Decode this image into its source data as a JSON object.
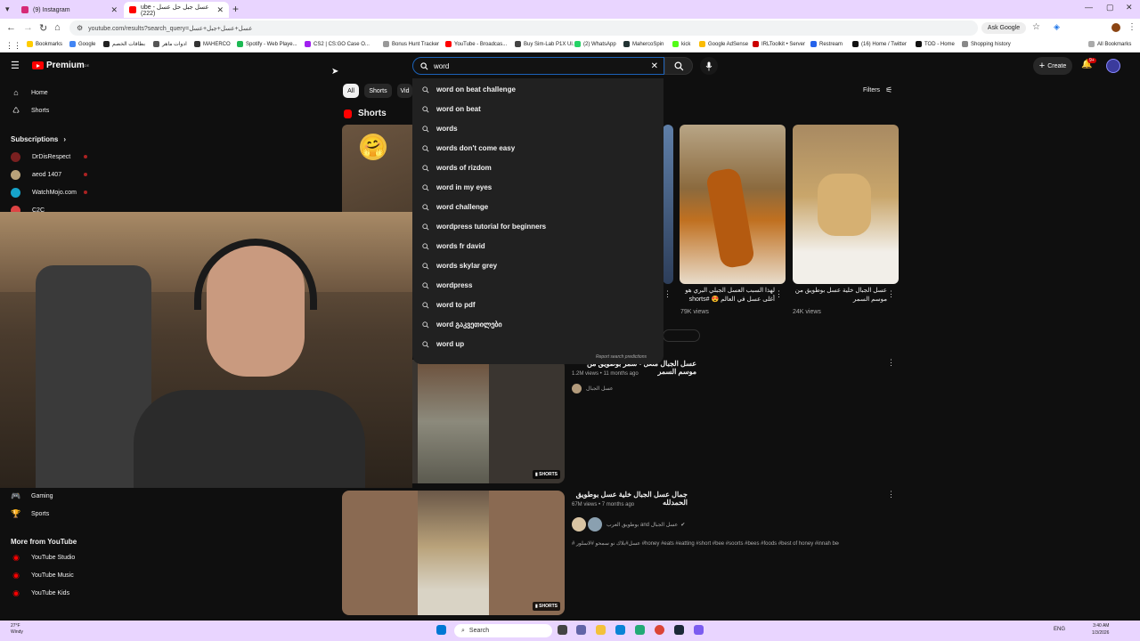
{
  "browser": {
    "tabs": [
      {
        "title": "(9) Instagram",
        "color": "#d62976"
      },
      {
        "title": "ube - عسل جبل حل عسل (222)",
        "color": "#ff0000"
      }
    ],
    "url": "youtube.com/results?search_query=عسل+عسل+جبل+عسل",
    "ask_google": "Ask Google",
    "bookmarks": [
      "Bookmarks",
      "Google",
      "بطاقات الخصم",
      "ادوات ماهر",
      "MAHERCO",
      "Spotify - Web Playe...",
      "CS2 | CS:GO Case O...",
      "Bonus Hunt Tracker",
      "YouTube - Broadcas...",
      "Buy Sim-Lab P1X Ul...",
      "(2) WhatsApp",
      "MahercoSpin",
      "kick",
      "Google AdSense",
      "IRLToolkit • Server",
      "Restream",
      "(16) Home / Twitter",
      "TOD - Home",
      "Shopping history"
    ],
    "all_bookmarks": "All Bookmarks"
  },
  "youtube": {
    "logo": "Premium",
    "logo_sup": "DE",
    "search_value": "word",
    "create_label": "Create",
    "notif_count": "9+",
    "accent": "#ff0000",
    "sidebar": {
      "home": "Home",
      "shorts": "Shorts",
      "subscriptions": "Subscriptions",
      "subs": [
        "DrDisRespect",
        "aeod 1407",
        "WatchMojo.com",
        "C2C"
      ],
      "gaming": "Gaming",
      "sports": "Sports",
      "more_from": "More from YouTube",
      "more": [
        "YouTube Studio",
        "YouTube Music",
        "YouTube Kids"
      ]
    },
    "chips": [
      "All",
      "Shorts",
      "Vid"
    ],
    "filters": "Filters",
    "shorts_title": "Shorts",
    "shorts": [
      {
        "caption": "لهذا السبب العسل الجبلي البري هو أغلى عسل في العالم 😍 #shorts",
        "views": "79K views"
      },
      {
        "caption": "عسل الجبال خلية عسل بوطويق من موسم السمر",
        "views": "24K views"
      }
    ],
    "suggestions": [
      "word on beat challenge",
      "word on beat",
      "words",
      "words don't come easy",
      "words of rizdom",
      "word in my eyes",
      "word challenge",
      "wordpress tutorial for beginners",
      "words fr david",
      "words skylar grey",
      "wordpress",
      "word to pdf",
      "word გაკვეთილები",
      "word up"
    ],
    "report": "Report search predictions",
    "results": [
      {
        "title": "عسل الجبال منعل - سمر بوطويق من موسم السمر",
        "meta": "1.2M views • 11 months ago",
        "channel": "عسل الجبال",
        "badge": "SHORTS"
      },
      {
        "title": "جمال عسل الجبال خلية عسل بوطويق الحمدلله",
        "meta": "67M views • 7 months ago",
        "channel": "بوطويق العرب and عسل الجبال",
        "desc": "# عسل#بلاك نو سمحو #لاسلور #honey #eats #eatting #short #bee #soorts #bees #foods #best of honey #innah bee ...",
        "badge": "SHORTS"
      }
    ]
  },
  "taskbar": {
    "weather_temp": "27°F",
    "weather_desc": "Windy",
    "search": "Search",
    "lang": "ENG",
    "time": "3:40 AM",
    "date": "1/3/2026"
  }
}
